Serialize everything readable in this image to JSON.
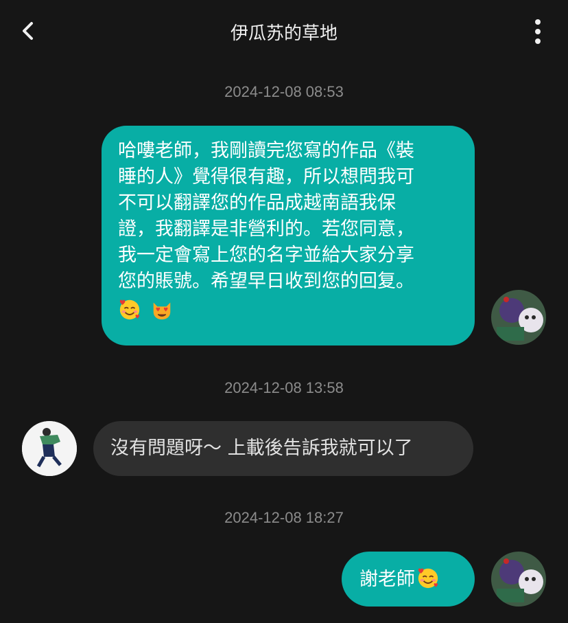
{
  "header": {
    "title": "伊瓜苏的草地",
    "back_icon": "chevron-left-icon",
    "more_icon": "vertical-dots-icon"
  },
  "messages": [
    {
      "timestamp": "2024-12-08 08:53",
      "direction": "sent",
      "lines": [
        "哈嘍老師，我剛讀完您寫的作品《裝",
        "睡的人》覺得很有趣，所以想問我可",
        "不可以翻譯您的作品成越南語我保",
        "證，我翻譯是非營利的。若您同意，",
        "我一定會寫上您的名字並給大家分享",
        "您的賬號。希望早日收到您的回复。"
      ],
      "emojis": [
        "smiling-face-with-hearts-icon",
        "heart-eyes-cat-icon"
      ]
    },
    {
      "timestamp": "2024-12-08 13:58",
      "direction": "received",
      "text": "沒有問題呀～ 上載後告訴我就可以了"
    },
    {
      "timestamp": "2024-12-08 18:27",
      "direction": "sent",
      "text": "謝老師",
      "emojis": [
        "smiling-face-with-hearts-icon"
      ]
    }
  ],
  "colors": {
    "background": "#161616",
    "sent_bubble": "#08aea5",
    "received_bubble": "#2f2f2f",
    "timestamp": "#8c8c8c"
  }
}
